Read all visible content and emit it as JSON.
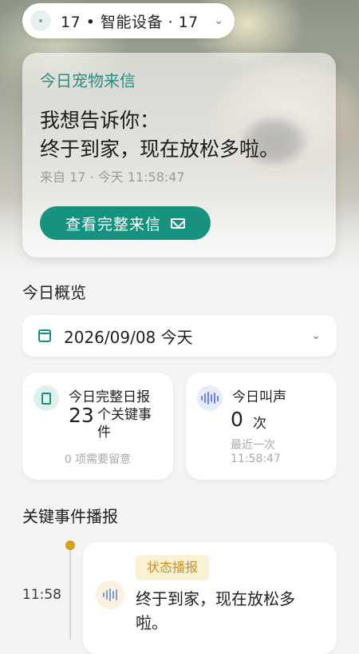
{
  "device_pill": {
    "text": "17 • 智能设备 · 17",
    "chevron": "⌄"
  },
  "letter_card": {
    "title": "今日宠物来信",
    "body_line1": "我想告诉你：",
    "body_line2": "终于到家，现在放松多啦。",
    "meta": "来自 17 · 今天 11:58:47",
    "button_label": "查看完整来信"
  },
  "overview": {
    "section_title": "今日概览",
    "date_label": "2026/09/08 今天",
    "report_card": {
      "title": "今日完整日报",
      "count": "23",
      "unit": "个关键事件",
      "sub": "0 项需要留意"
    },
    "bark_card": {
      "title": "今日叫声",
      "count": "0",
      "unit": "次",
      "sub_line1": "最近一次",
      "sub_line2": "11:58:47"
    }
  },
  "events": {
    "section_title": "关键事件播报",
    "items": [
      {
        "time": "11:58",
        "badge": "状态播报",
        "text": "终于到家，现在放松多啦。"
      }
    ]
  },
  "colors": {
    "accent": "#17927f",
    "badge_text": "#c9901d",
    "timeline_dot": "#d4a017"
  },
  "icons": [
    "calendar-icon",
    "mail-icon",
    "report-icon",
    "sound-wave-icon",
    "chevron-down-icon"
  ]
}
